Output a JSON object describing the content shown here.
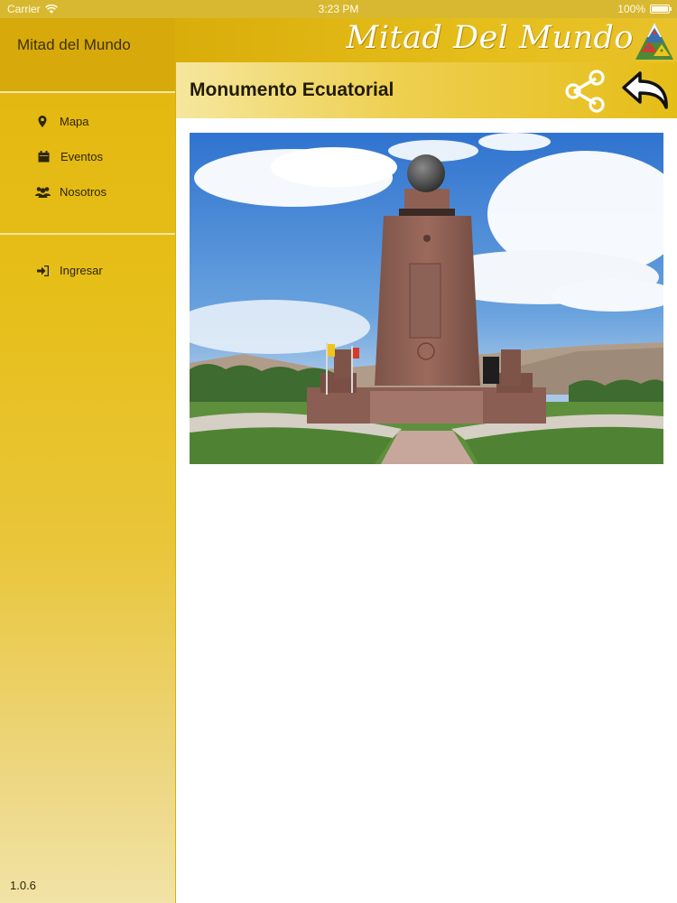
{
  "status_bar": {
    "carrier": "Carrier",
    "time": "3:23 PM",
    "battery": "100%"
  },
  "sidebar": {
    "title": "Mitad del Mundo",
    "menu": [
      {
        "label": "Mapa",
        "icon": "map-marker-icon"
      },
      {
        "label": "Eventos",
        "icon": "calendar-icon"
      },
      {
        "label": "Nosotros",
        "icon": "users-icon"
      }
    ],
    "login": {
      "label": "Ingresar",
      "icon": "sign-in-icon"
    },
    "version": "1.0.6"
  },
  "header": {
    "brand": "Mitad Del Mundo",
    "title": "Monumento Ecuatorial",
    "share_icon": "share-icon",
    "back_icon": "back-arrow-icon"
  },
  "colors": {
    "primary": "#e2b60e",
    "sidebar_dark": "#d7a90a",
    "title_bar_light": "#f5e79e",
    "text": "#221b00"
  }
}
